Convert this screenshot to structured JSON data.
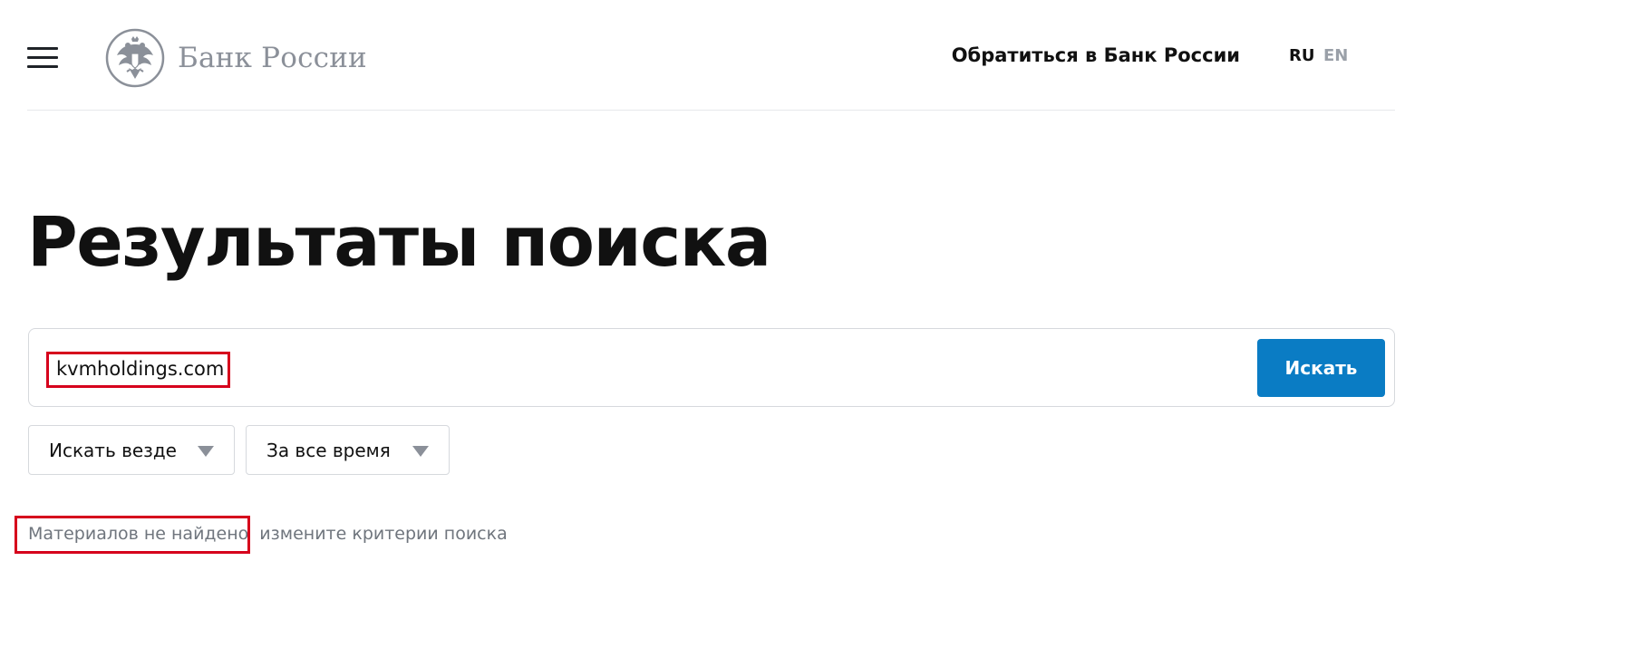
{
  "header": {
    "menu_icon": "hamburger-menu-icon",
    "logo_icon": "double-headed-eagle-emblem-icon",
    "logo_text": "Банк России",
    "contact_link": "Обратиться в Банк России",
    "lang_ru": "RU",
    "lang_en": "EN"
  },
  "main": {
    "title": "Результаты поиска",
    "search": {
      "value": "kvmholdings.com",
      "placeholder": "",
      "button_label": "Искать"
    },
    "filters": {
      "scope": "Искать везде",
      "period": "За все время",
      "dropdown_icon": "triangle-down-icon"
    },
    "result": {
      "status": "Материалов не найдено",
      "hint": "измените критерии поиска"
    }
  },
  "colors": {
    "primary_button": "#0a7cc4",
    "highlight": "#d6001c",
    "muted_text": "#6f757d",
    "logo_gray": "#8b9099"
  }
}
